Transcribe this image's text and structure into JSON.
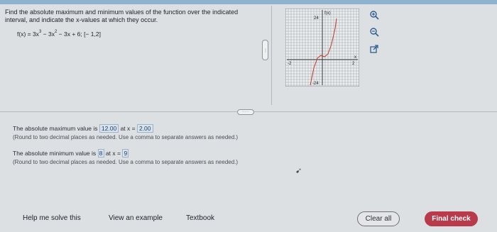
{
  "question": {
    "instructions": "Find the absolute maximum and minimum values of the function over the indicated interval, and indicate the x-values at which they occur.",
    "function_prefix": "f(x) = 3x",
    "exp1": "3",
    "function_mid": " − 3x",
    "exp2": "2",
    "function_suffix": " − 3x + 6; [− 1,2]"
  },
  "graph": {
    "axis_label_y": "f(x)",
    "axis_label_x": "x",
    "tick_top": "24",
    "tick_bottom": "-24",
    "tick_right": "2",
    "tick_left": "-2",
    "zoom_in_icon": "zoom-in-icon",
    "zoom_out_icon": "zoom-out-icon",
    "popout_icon": "external-link-icon"
  },
  "answers": {
    "max_prefix": "The absolute maximum value is",
    "max_value": "12.00",
    "max_mid": "at x =",
    "max_x": "2.00",
    "max_note": "(Round to two decimal places as needed. Use a comma to separate answers as needed.)",
    "min_prefix": "The absolute minimum value is",
    "min_value": "8",
    "min_mid": "at x =",
    "min_x": "9",
    "min_note": "(Round to two decimal places as needed. Use a comma to separate answers as needed.)"
  },
  "footer": {
    "help": "Help me solve this",
    "example": "View an example",
    "textbook": "Textbook",
    "clear": "Clear all",
    "final": "Final check"
  },
  "colors": {
    "accent": "#b83a4b",
    "answer_box": "#d7e4ef"
  }
}
